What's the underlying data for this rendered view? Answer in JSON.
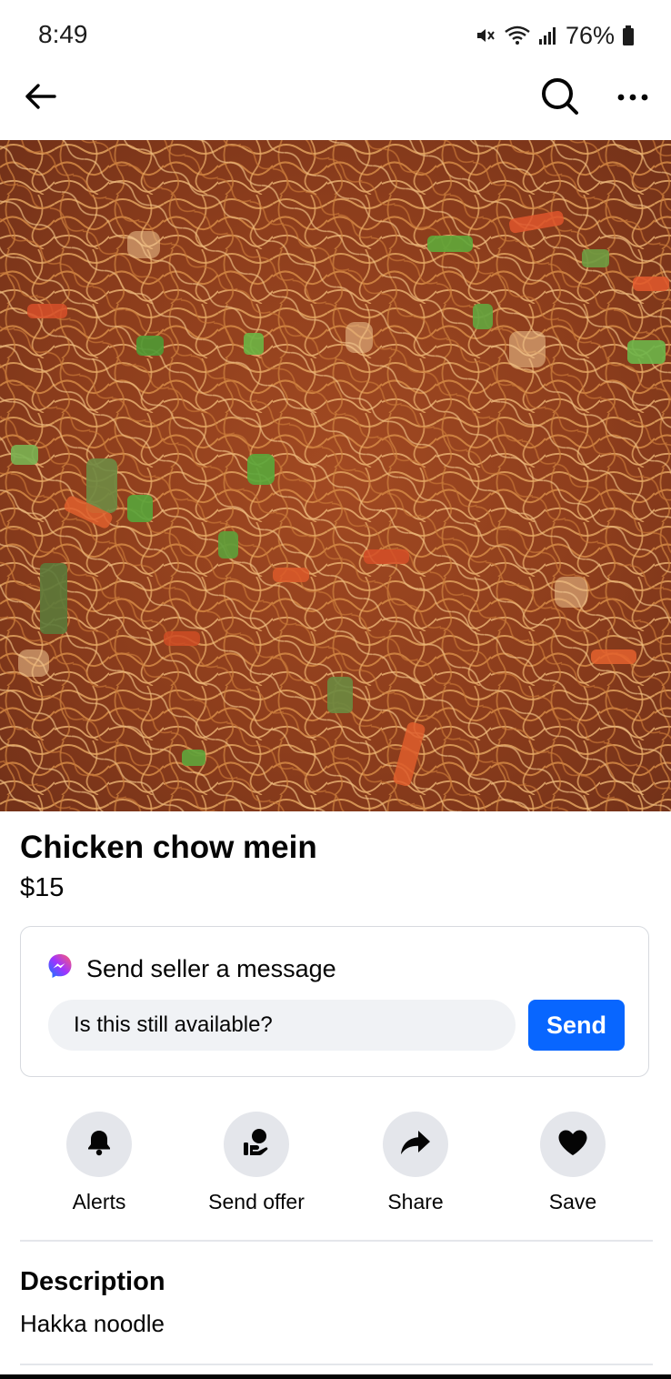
{
  "status_bar": {
    "time": "8:49",
    "battery": "76%"
  },
  "listing": {
    "title": "Chicken chow mein",
    "price": "$15",
    "image_alt": "Chicken chow mein"
  },
  "message": {
    "heading": "Send seller a message",
    "input_value": "Is this still available?",
    "send_label": "Send"
  },
  "actions": [
    {
      "label": "Alerts",
      "icon": "bell-icon"
    },
    {
      "label": "Send offer",
      "icon": "offer-hand-icon"
    },
    {
      "label": "Share",
      "icon": "share-arrow-icon"
    },
    {
      "label": "Save",
      "icon": "heart-icon"
    }
  ],
  "description": {
    "heading": "Description",
    "text": "Hakka noodle"
  },
  "colors": {
    "accent": "#0866ff",
    "icon_bg": "#e4e6eb",
    "input_bg": "#f0f2f5"
  }
}
